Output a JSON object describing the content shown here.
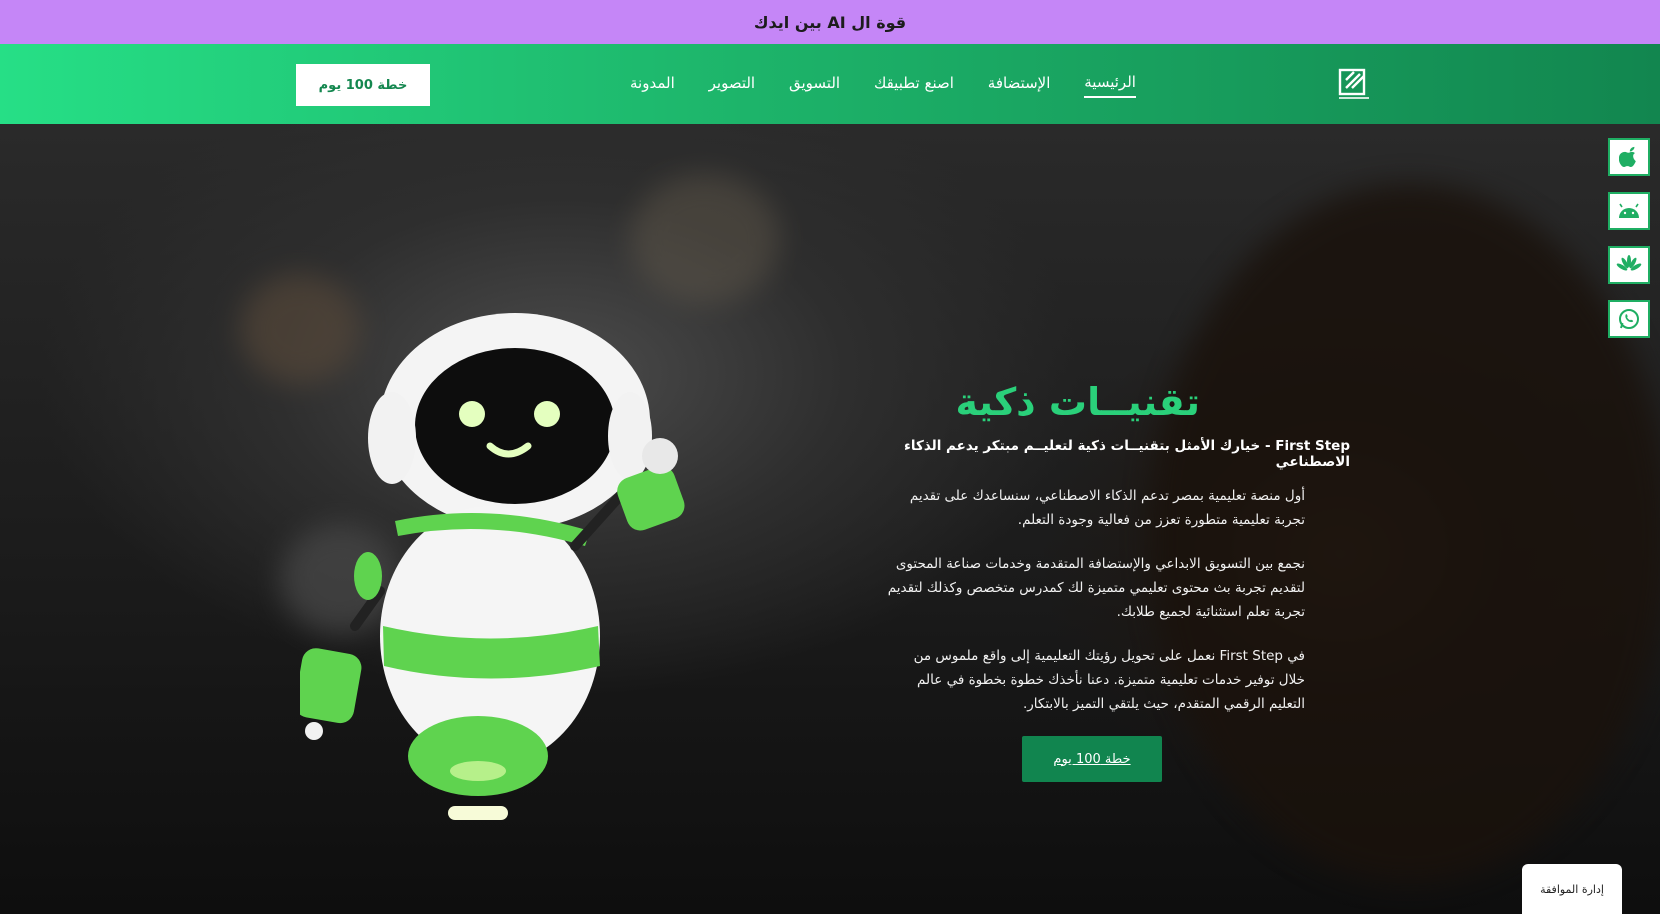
{
  "announcement": {
    "text": "قوة ال AI بين ايدك"
  },
  "navbar": {
    "logo_alt": "FIRST STEP",
    "links": [
      {
        "label": "الرئيسية",
        "active": true
      },
      {
        "label": "الإستضافة"
      },
      {
        "label": "اصنع تطبيقك"
      },
      {
        "label": "التسويق"
      },
      {
        "label": "التصوير"
      },
      {
        "label": "المدونة"
      }
    ],
    "cta_label": "خطة 100 يوم"
  },
  "side_icons": [
    "apple-icon",
    "android-icon",
    "huawei-icon",
    "whatsapp-icon"
  ],
  "hero": {
    "title": "تقنيــات ذكية",
    "subtitle": "First Step - خيارك الأمثل بتقنيــات ذكية لتعليــم مبتكر يدعم الذكاء الاصطناعي",
    "paragraphs": [
      "أول منصة تعليمية بمصر تدعم الذكاء الاصطناعي، سنساعدك على تقديم تجربة تعليمية متطورة تعزز من فعالية وجودة التعلم.",
      "نجمع بين التسويق الابداعي والإستضافة المتقدمة وخدمات صناعة المحتوى لتقديم تجربة بث محتوى تعليمي متميزة لك كمدرس متخصص وكذلك لتقديم تجربة تعلم استثنائية لجميع طلابك.",
      "في First Step نعمل على تحويل رؤيتك التعليمية إلى واقع ملموس من خلال توفير خدمات تعليمية متميزة. دعنا نأخذك خطوة بخطوة في عالم التعليم الرقمي المتقدم، حيث يلتقي التميز بالابتكار."
    ],
    "cta_label": "خطة 100 يوم"
  },
  "consent": {
    "label": "إدارة الموافقة"
  },
  "colors": {
    "brand_green": "#1db46a",
    "dark_green": "#11854f",
    "announcement_purple": "#c586f7",
    "title_green": "#2ad07a"
  }
}
